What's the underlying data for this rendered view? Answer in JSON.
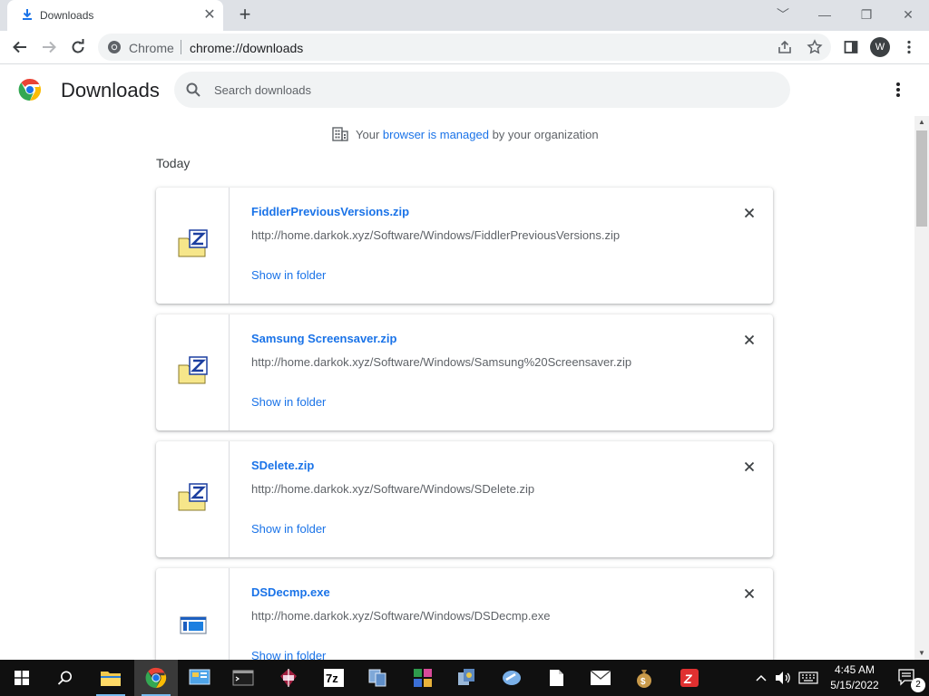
{
  "window": {
    "tab_title": "Downloads",
    "tab_close_glyph": "✕",
    "new_tab_glyph": "+",
    "controls": [
      "﹀",
      "—",
      "❐",
      "✕"
    ]
  },
  "toolbar": {
    "site_label": "Chrome",
    "url": "chrome://downloads",
    "avatar_letter": "W"
  },
  "header": {
    "title": "Downloads",
    "search_placeholder": "Search downloads"
  },
  "notice": {
    "prefix": "Your ",
    "link": "browser is managed",
    "suffix": " by your organization"
  },
  "section": {
    "date": "Today"
  },
  "downloads": [
    {
      "name": "FiddlerPreviousVersions.zip",
      "url": "http://home.darkok.xyz/Software/Windows/FiddlerPreviousVersions.zip",
      "action": "Show in folder",
      "icon": "zip-archive-icon"
    },
    {
      "name": "Samsung Screensaver.zip",
      "url": "http://home.darkok.xyz/Software/Windows/Samsung%20Screensaver.zip",
      "action": "Show in folder",
      "icon": "zip-archive-icon"
    },
    {
      "name": "SDelete.zip",
      "url": "http://home.darkok.xyz/Software/Windows/SDelete.zip",
      "action": "Show in folder",
      "icon": "zip-archive-icon"
    },
    {
      "name": "DSDecmp.exe",
      "url": "http://home.darkok.xyz/Software/Windows/DSDecmp.exe",
      "action": "Show in folder",
      "icon": "executable-icon"
    }
  ],
  "taskbar": {
    "time": "4:45 AM",
    "date": "5/15/2022",
    "notification_count": "2",
    "items": [
      "start-icon",
      "search-icon",
      "file-explorer-icon",
      "chrome-icon",
      "control-panel-icon",
      "terminal-icon",
      "winrar-icon",
      "7zip-icon",
      "network-icon",
      "registry-icon",
      "app-icon",
      "speed-icon",
      "files-icon",
      "mail-icon",
      "money-bag-icon",
      "app-red-icon"
    ]
  },
  "colors": {
    "accent": "#1a73e8",
    "tabstrip": "#dee1e6",
    "taskbar": "#101010"
  }
}
